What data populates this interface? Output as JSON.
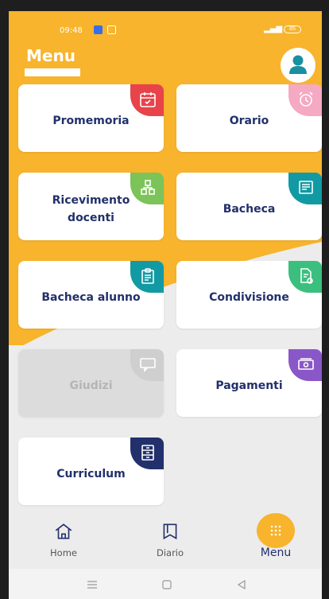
{
  "colors": {
    "primary": "#f7b42c",
    "navy": "#22306b",
    "red": "#e8434a",
    "pink": "#f5a9c3",
    "green": "#7cc35a",
    "teal": "#119aa3",
    "purple": "#8a57c8",
    "mint": "#3bbf7e",
    "gray": "#cfcfcf"
  },
  "status": {
    "time": "09:48",
    "battery": "85"
  },
  "header": {
    "title": "Menu",
    "avatar_icon": "user-icon"
  },
  "cards": [
    {
      "label": "Promemoria",
      "icon": "calendar-check-icon",
      "color": "red"
    },
    {
      "label": "Orario",
      "icon": "alarm-clock-icon",
      "color": "pink"
    },
    {
      "label": "Ricevimento docenti",
      "icon": "network-people-icon",
      "color": "green"
    },
    {
      "label": "Bacheca",
      "icon": "notice-board-icon",
      "color": "teal"
    },
    {
      "label": "Bacheca alunno",
      "icon": "clipboard-icon",
      "color": "teal"
    },
    {
      "label": "Condivisione",
      "icon": "share-doc-icon",
      "color": "mint"
    },
    {
      "label": "Giudizi",
      "icon": "chat-icon",
      "color": "gray",
      "disabled": true
    },
    {
      "label": "Pagamenti",
      "icon": "money-icon",
      "color": "purple"
    },
    {
      "label": "Curriculum",
      "icon": "file-cabinet-icon",
      "color": "navy"
    }
  ],
  "nav": {
    "home": "Home",
    "diario": "Diario",
    "menu": "Menu"
  }
}
